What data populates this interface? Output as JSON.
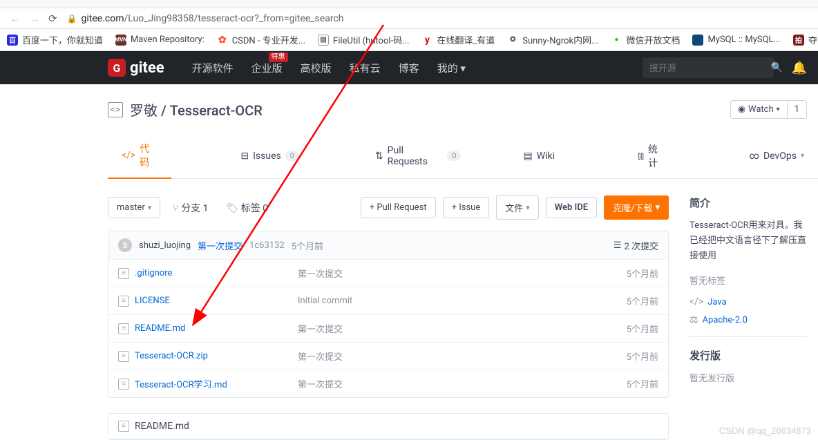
{
  "browser": {
    "url_host": "gitee.com",
    "url_path": "/Luo_Jing98358/tesseract-ocr?_from=gitee_search"
  },
  "bookmarks": [
    {
      "label": "百度一下，你就知道"
    },
    {
      "label": "Maven Repository:"
    },
    {
      "label": "CSDN - 专业开发..."
    },
    {
      "label": "FileUtil (hutool-码..."
    },
    {
      "label": "在线翻译_有道"
    },
    {
      "label": "Sunny-Ngrok内网..."
    },
    {
      "label": "微信开放文档"
    },
    {
      "label": "MySQL :: MySQL..."
    },
    {
      "label": "夺宝岛列表"
    }
  ],
  "header": {
    "brand": "gitee",
    "nav": [
      "开源软件",
      "企业版",
      "高校版",
      "私有云",
      "博客",
      "我的 ▾"
    ],
    "badge": "特惠",
    "search_placeholder": "搜开源"
  },
  "repo": {
    "owner": "罗敬",
    "name": "Tesseract-OCR",
    "watch_label": "Watch",
    "watch_count": "1"
  },
  "tabs": {
    "code": "代码",
    "issues": "Issues",
    "issues_badge": "0",
    "pr": "Pull Requests",
    "pr_badge": "0",
    "wiki": "Wiki",
    "stats": "统计",
    "devops": "DevOps"
  },
  "toolbar": {
    "branch": "master",
    "branch_stat": "分支 1",
    "tag_stat": "标签 0",
    "pull_request": "+ Pull Request",
    "issue": "+ Issue",
    "files": "文件",
    "webide": "Web IDE",
    "clone": "克隆/下载"
  },
  "commit_header": {
    "avatar_letter": "S",
    "author": "shuzi_luojing",
    "msg": "第一次提交",
    "sha": "1c63132",
    "age": "5个月前",
    "total": "2 次提交"
  },
  "files": [
    {
      "name": ".gitignore",
      "msg": "第一次提交",
      "time": "5个月前"
    },
    {
      "name": "LICENSE",
      "msg": "Initial commit",
      "time": "5个月前"
    },
    {
      "name": "README.md",
      "msg": "第一次提交",
      "time": "5个月前"
    },
    {
      "name": "Tesseract-OCR.zip",
      "msg": "第一次提交",
      "time": "5个月前"
    },
    {
      "name": "Tesseract-OCR学习.md",
      "msg": "第一次提交",
      "time": "5个月前"
    }
  ],
  "readme_title": "README.md",
  "sidebar": {
    "intro_title": "简介",
    "intro_text": "Tesseract-OCR用来对具。我已经把中文语言径下了解压直接使用",
    "no_tags": "暂无标签",
    "lang": "Java",
    "license": "Apache-2.0",
    "release_title": "发行版",
    "no_release": "暂无发行版"
  },
  "watermark": "CSDN @qq_26634873"
}
